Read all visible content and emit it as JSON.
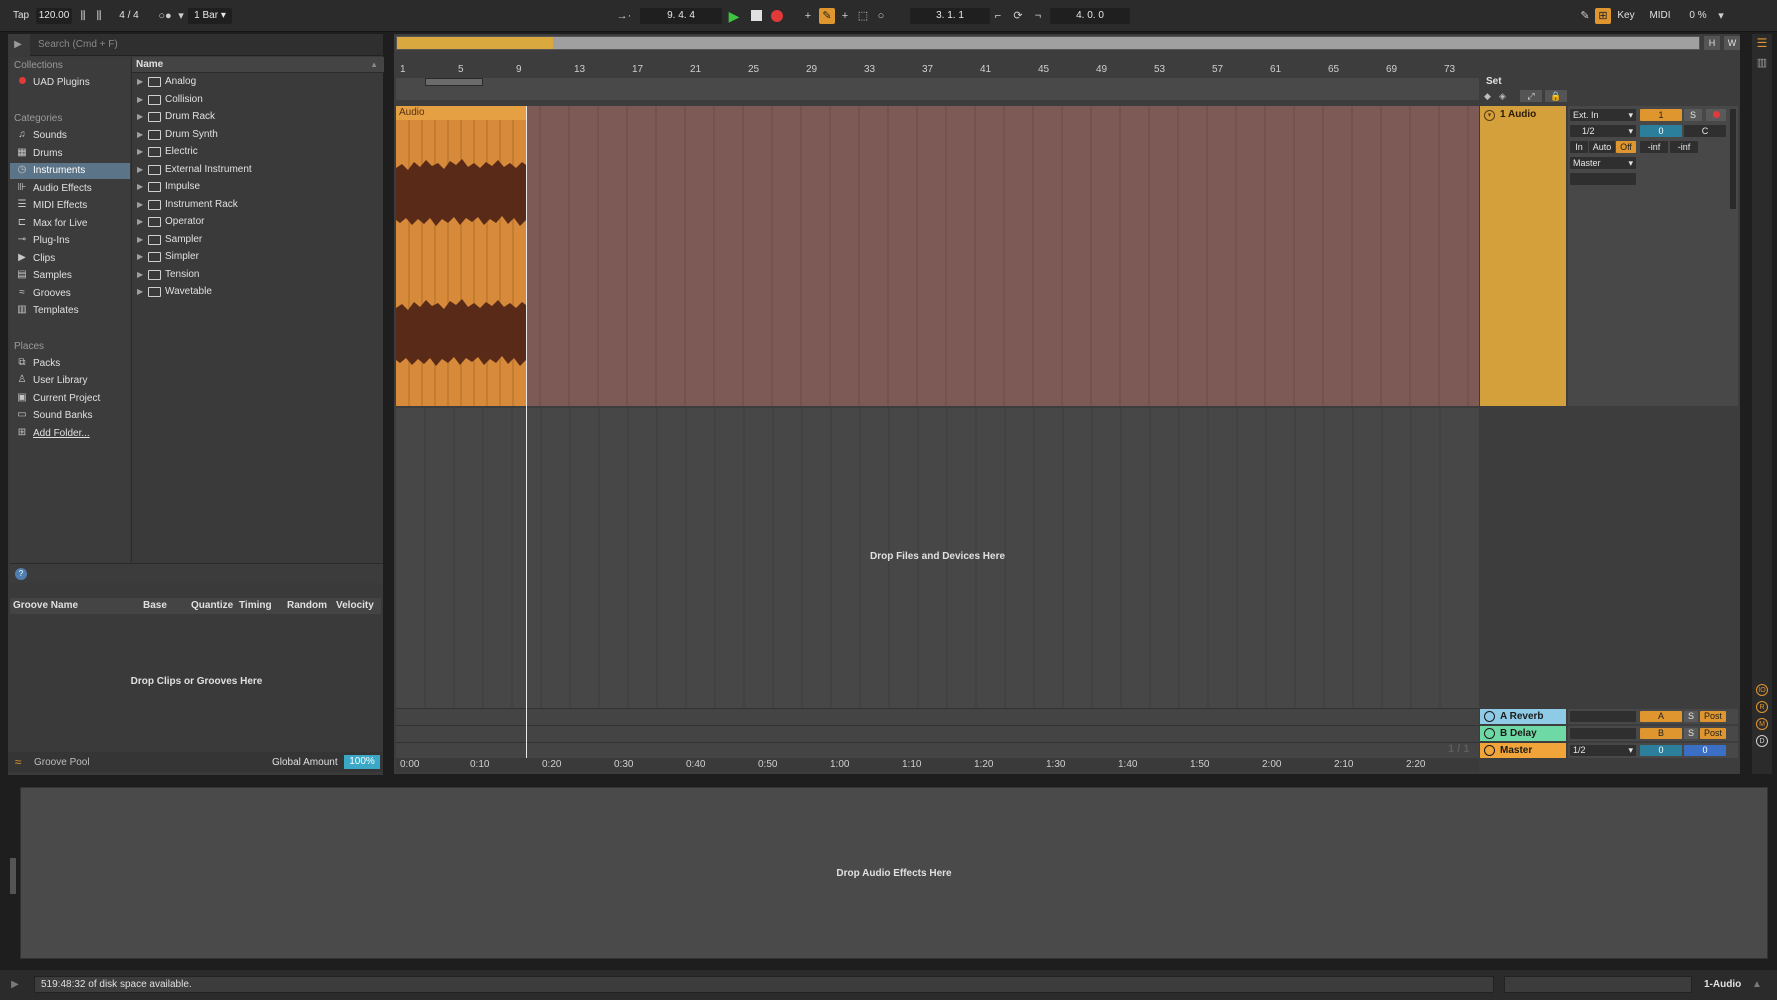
{
  "transport": {
    "tap": "Tap",
    "tempo": "120.00",
    "signature": "4 / 4",
    "quantize": "1 Bar",
    "position": "9.  4.  4",
    "loop_start": "3.  1.  1",
    "loop_length": "4.  0.  0",
    "key_label": "Key",
    "midi_label": "MIDI",
    "cpu": "0 %"
  },
  "browser": {
    "search_placeholder": "Search (Cmd + F)",
    "collections_title": "Collections",
    "collections": [
      {
        "label": "UAD Plugins"
      }
    ],
    "categories_title": "Categories",
    "categories": [
      {
        "label": "Sounds"
      },
      {
        "label": "Drums"
      },
      {
        "label": "Instruments"
      },
      {
        "label": "Audio Effects"
      },
      {
        "label": "MIDI Effects"
      },
      {
        "label": "Max for Live"
      },
      {
        "label": "Plug-Ins"
      },
      {
        "label": "Clips"
      },
      {
        "label": "Samples"
      },
      {
        "label": "Grooves"
      },
      {
        "label": "Templates"
      }
    ],
    "places_title": "Places",
    "places": [
      {
        "label": "Packs"
      },
      {
        "label": "User Library"
      },
      {
        "label": "Current Project"
      },
      {
        "label": "Sound Banks"
      },
      {
        "label": "Add Folder..."
      }
    ],
    "name_header": "Name",
    "items": [
      {
        "label": "Analog"
      },
      {
        "label": "Collision"
      },
      {
        "label": "Drum Rack"
      },
      {
        "label": "Drum Synth"
      },
      {
        "label": "Electric"
      },
      {
        "label": "External Instrument"
      },
      {
        "label": "Impulse"
      },
      {
        "label": "Instrument Rack"
      },
      {
        "label": "Operator"
      },
      {
        "label": "Sampler"
      },
      {
        "label": "Simpler"
      },
      {
        "label": "Tension"
      },
      {
        "label": "Wavetable"
      }
    ]
  },
  "groove": {
    "headers": [
      "Groove Name",
      "Base",
      "Quantize",
      "Timing",
      "Random",
      "Velocity"
    ],
    "empty_text": "Drop Clips or Grooves Here",
    "pool_label": "Groove Pool",
    "global_amount_label": "Global Amount",
    "global_amount": "100%"
  },
  "arrangement": {
    "bars": [
      "1",
      "5",
      "9",
      "13",
      "17",
      "21",
      "25",
      "29",
      "33",
      "37",
      "41",
      "45",
      "49",
      "53",
      "57",
      "61",
      "65",
      "69",
      "73"
    ],
    "times": [
      "0:00",
      "0:10",
      "0:20",
      "0:30",
      "0:40",
      "0:50",
      "1:00",
      "1:10",
      "1:20",
      "1:30",
      "1:40",
      "1:50",
      "2:00",
      "2:10",
      "2:20"
    ],
    "clip_name": "Audio",
    "drop_text": "Drop Files and Devices Here",
    "set_label": "Set",
    "overview_h": "H",
    "overview_w": "W",
    "page_indicator": "1 / 1"
  },
  "track": {
    "name": "1 Audio",
    "input": "Ext. In",
    "channel": "1/2",
    "output": "Master",
    "number": "1",
    "solo": "S",
    "volume": "0",
    "pan": "C",
    "monitor_in": "In",
    "monitor_auto": "Auto",
    "monitor_off": "Off",
    "peak_left": "-inf",
    "peak_right": "-inf"
  },
  "returns": [
    {
      "name": "A Reverb",
      "letter": "A",
      "solo": "S",
      "post": "Post",
      "color": "#8ecbe6"
    },
    {
      "name": "B Delay",
      "letter": "B",
      "solo": "S",
      "post": "Post",
      "color": "#6fd9a6"
    },
    {
      "name": "Master",
      "letter": "0",
      "solo": "",
      "post": "",
      "color": "#f0a43a",
      "channel": "1/2",
      "volume": "0"
    }
  ],
  "device": {
    "drop_text": "Drop Audio Effects Here"
  },
  "status": {
    "message": "519:48:32 of disk space available.",
    "track_name": "1-Audio"
  },
  "colors": {
    "track": "#d4a03c",
    "clip": "#d68a3a",
    "selected_category": "#5b7487",
    "play": "#3ec43e",
    "record": "#e03a3a"
  }
}
